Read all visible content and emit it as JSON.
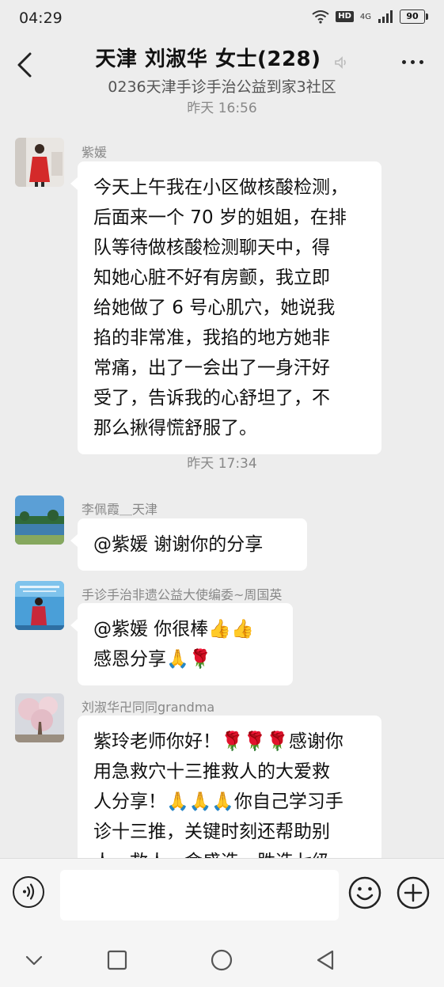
{
  "status_bar": {
    "time": "04:29",
    "hd": "HD",
    "network": "4G",
    "battery": "90"
  },
  "header": {
    "title": "天津 刘淑华 女士(228)",
    "subtitle": "0236天津手诊手治公益到家3社区"
  },
  "colors": {
    "background": "#ededed",
    "bubble": "#ffffff",
    "meta_text": "#888888"
  },
  "messages": [
    {
      "type": "timestamp",
      "text": "昨天 16:56"
    },
    {
      "type": "message",
      "sender": "紫媛",
      "lines": [
        "今天上午我在小区做核酸检测，",
        "后面来一个 70 岁的姐姐，在排",
        "队等待做核酸检测聊天中，得",
        "知她心脏不好有房颤，我立即",
        "给她做了 6 号心肌穴，她说我",
        "掐的非常准，我掐的地方她非",
        "常痛，出了一会出了一身汗好",
        "受了，告诉我的心舒坦了，不",
        "那么揪得慌舒服了。"
      ]
    },
    {
      "type": "timestamp",
      "text": "昨天 17:34"
    },
    {
      "type": "message",
      "sender": "李佩霞＿天津",
      "lines": [
        "@紫媛  谢谢你的分享"
      ]
    },
    {
      "type": "message",
      "sender": "手诊手治非遗公益大使编委~周国英",
      "lines": [
        "@紫媛  你很棒👍👍",
        "感恩分享🙏🌹"
      ]
    },
    {
      "type": "message",
      "sender": "刘淑华卍同同grandma",
      "lines": [
        "紫玲老师你好！🌹🌹🌹感谢你",
        "用急救穴十三推救人的大爱救",
        "人分享！🙏🙏🙏你自己学习手",
        "诊十三推，关键时刻还帮助别",
        "人，救人一命盛造，胜造七级"
      ]
    }
  ],
  "input": {
    "placeholder": ""
  }
}
